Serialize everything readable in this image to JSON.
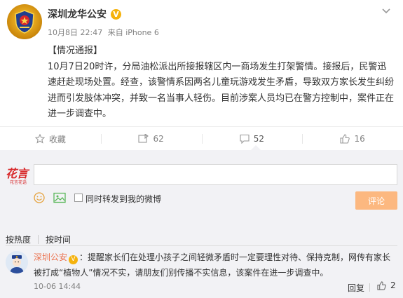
{
  "post": {
    "author": "深圳龙华公安",
    "verified_mark": "V",
    "time": "10月8日 22:47",
    "source": "来自 iPhone 6",
    "content": "【情况通报】\n10月7日20时许，分局油松派出所接报辖区内一商场发生打架警情。接报后，民警迅速赶赴现场处置。经查，该警情系因两名儿童玩游戏发生矛盾，导致双方家长发生纠纷进而引发肢体冲突，并致一名当事人轻伤。目前涉案人员均已在警方控制中，案件正在进一步调查中。"
  },
  "actions": {
    "favorite": "收藏",
    "repost_count": "62",
    "comment_count": "52",
    "like_count": "16"
  },
  "compose": {
    "logo_text": "花言",
    "logo_subtext": "花言花语",
    "input_value": "",
    "also_repost_label": "同时转发到我的微博",
    "submit_label": "评论"
  },
  "sort": {
    "by_hot": "按热度",
    "by_time": "按时间"
  },
  "comment": {
    "author": "深圳公安",
    "vip_mark": "V",
    "text": "：提醒家长们在处理小孩子之间轻微矛盾时一定要理性对待、保持克制，网传有家长被打成“植物人”情况不实，请朋友们别传播不实信息，该案件在进一步调查中。",
    "time": "10-06 14:44",
    "reply_label": "回复",
    "like_count": "2"
  },
  "colors": {
    "accent_orange": "#eb7350",
    "submit_disabled": "#fcb880",
    "verified_gold": "#f5b20c",
    "compose_bg": "#f2f2f5"
  }
}
